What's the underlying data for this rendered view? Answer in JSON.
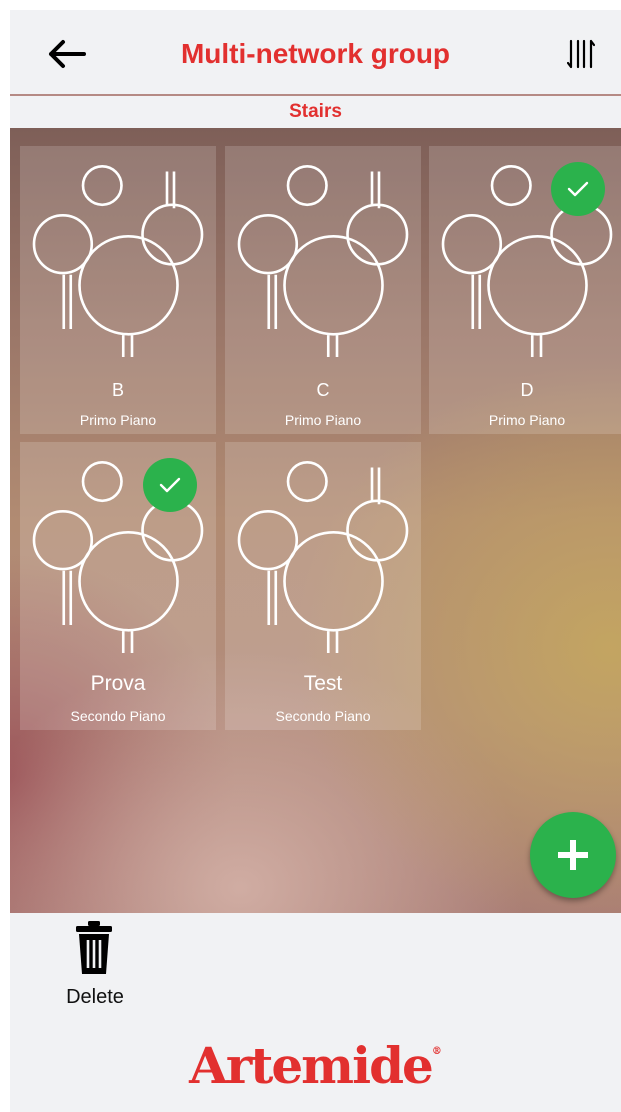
{
  "header": {
    "title": "Multi-network group",
    "back_icon": "arrow-left-icon",
    "sort_icon": "sort-arrows-icon"
  },
  "group": {
    "name": "Stairs"
  },
  "tiles": [
    {
      "name": "B",
      "floor": "Primo Piano",
      "selected": false
    },
    {
      "name": "C",
      "floor": "Primo Piano",
      "selected": false
    },
    {
      "name": "D",
      "floor": "Primo Piano",
      "selected": true
    },
    {
      "name": "Prova",
      "floor": "Secondo Piano",
      "selected": true
    },
    {
      "name": "Test",
      "floor": "Secondo Piano",
      "selected": false
    }
  ],
  "toolbar": {
    "delete_label": "Delete",
    "delete_icon": "trash-icon",
    "add_icon": "plus-icon"
  },
  "brand": {
    "logo_text": "Artemide"
  },
  "colors": {
    "accent_red": "#e2302f",
    "success_green": "#2bb24c",
    "background": "#f1f2f4"
  }
}
